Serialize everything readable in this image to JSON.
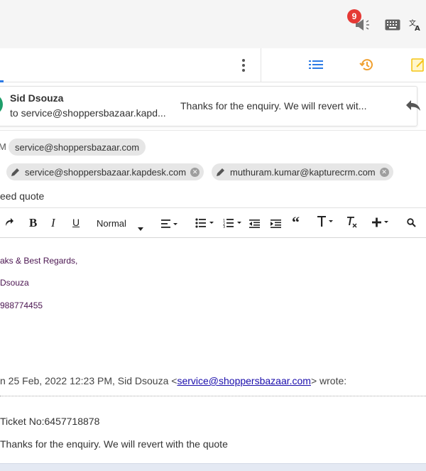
{
  "header": {
    "notification_count": "9"
  },
  "conversation": {
    "sender": "Sid Dsouza",
    "to_line": "to service@shoppersbazaar.kapd...",
    "snippet": "Thanks for the enquiry. We will revert wit..."
  },
  "composer": {
    "from_label": "M",
    "from_chip": "service@shoppersbazaar.com",
    "to_chips": [
      "service@shoppersbazaar.kapdesk.com",
      "muthuram.kumar@kapturecrm.com"
    ],
    "subject": "eed quote",
    "format_select": "Normal"
  },
  "body": {
    "signature": {
      "line1": "aks & Best Regards,",
      "line2": "Dsouza",
      "line3": "988774455"
    },
    "quote": {
      "prefix": "n 25 Feb, 2022 12:23 PM, Sid Dsouza <",
      "email": "service@shoppersbazaar.com",
      "suffix": "> wrote:"
    },
    "ticket_line": "Ticket No:6457718878",
    "message_line": "Thanks for the enquiry. We will revert with the quote"
  },
  "colors": {
    "accent_blue": "#2d7be5",
    "history_orange": "#f0a030",
    "badge_red": "#e53935",
    "signature_purple": "#4a1450"
  },
  "icons": [
    "megaphone-icon",
    "keyboard-icon",
    "translate-icon",
    "more-vert-icon",
    "list-icon",
    "history-icon",
    "note-icon",
    "reply-icon",
    "pencil-icon",
    "close-icon",
    "redo-icon",
    "bold-icon",
    "italic-icon",
    "underline-icon",
    "align-icon",
    "bullet-list-icon",
    "numbered-list-icon",
    "outdent-icon",
    "indent-icon",
    "quote-icon",
    "text-style-icon",
    "clear-format-icon",
    "plus-icon",
    "search-icon"
  ]
}
